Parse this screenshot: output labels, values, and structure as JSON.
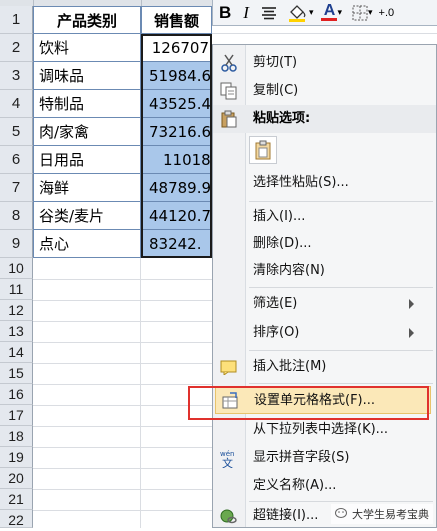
{
  "sheet": {
    "header": {
      "row": "1",
      "colA": "产品类别",
      "colB": "销售额"
    },
    "rows": [
      {
        "row": "2",
        "a": "饮料",
        "b": "126707"
      },
      {
        "row": "3",
        "a": "调味品",
        "b": "51984.6"
      },
      {
        "row": "4",
        "a": "特制品",
        "b": "43525.4"
      },
      {
        "row": "5",
        "a": "肉/家禽",
        "b": "73216.6"
      },
      {
        "row": "6",
        "a": "日用品",
        "b": "11018."
      },
      {
        "row": "7",
        "a": "海鲜",
        "b": "48789.9"
      },
      {
        "row": "8",
        "a": "谷类/麦片",
        "b": "44120.7"
      },
      {
        "row": "9",
        "a": "点心",
        "b": "83242."
      }
    ],
    "empty_rows": [
      "10",
      "11",
      "12",
      "13",
      "14",
      "15",
      "16",
      "17",
      "18",
      "19",
      "20",
      "21",
      "22"
    ]
  },
  "toolbar": {
    "bold": "B",
    "italic": "I",
    "align_icon": "align-center-icon",
    "fill_icon": "fill-color-icon",
    "font_color": "A",
    "border_icon": "border-icon",
    "extra": "+.0"
  },
  "menu": {
    "cut": "剪切(T)",
    "copy": "复制(C)",
    "paste_options": "粘贴选项:",
    "paste_special": "选择性粘贴(S)...",
    "insert": "插入(I)...",
    "delete": "删除(D)...",
    "clear": "清除内容(N)",
    "filter": "筛选(E)",
    "sort": "排序(O)",
    "insert_comment": "插入批注(M)",
    "format_cells": "设置单元格格式(F)...",
    "pick_list": "从下拉列表中选择(K)...",
    "phonetic": "显示拼音字段(S)",
    "define_name": "定义名称(A)...",
    "hyperlink": "超链接(I)..."
  },
  "watermark": "大学生易考宝典",
  "colors": {
    "selection": "#a9c7ea",
    "highlight_border": "#e0312d",
    "menu_bg": "#f5f6f7"
  }
}
